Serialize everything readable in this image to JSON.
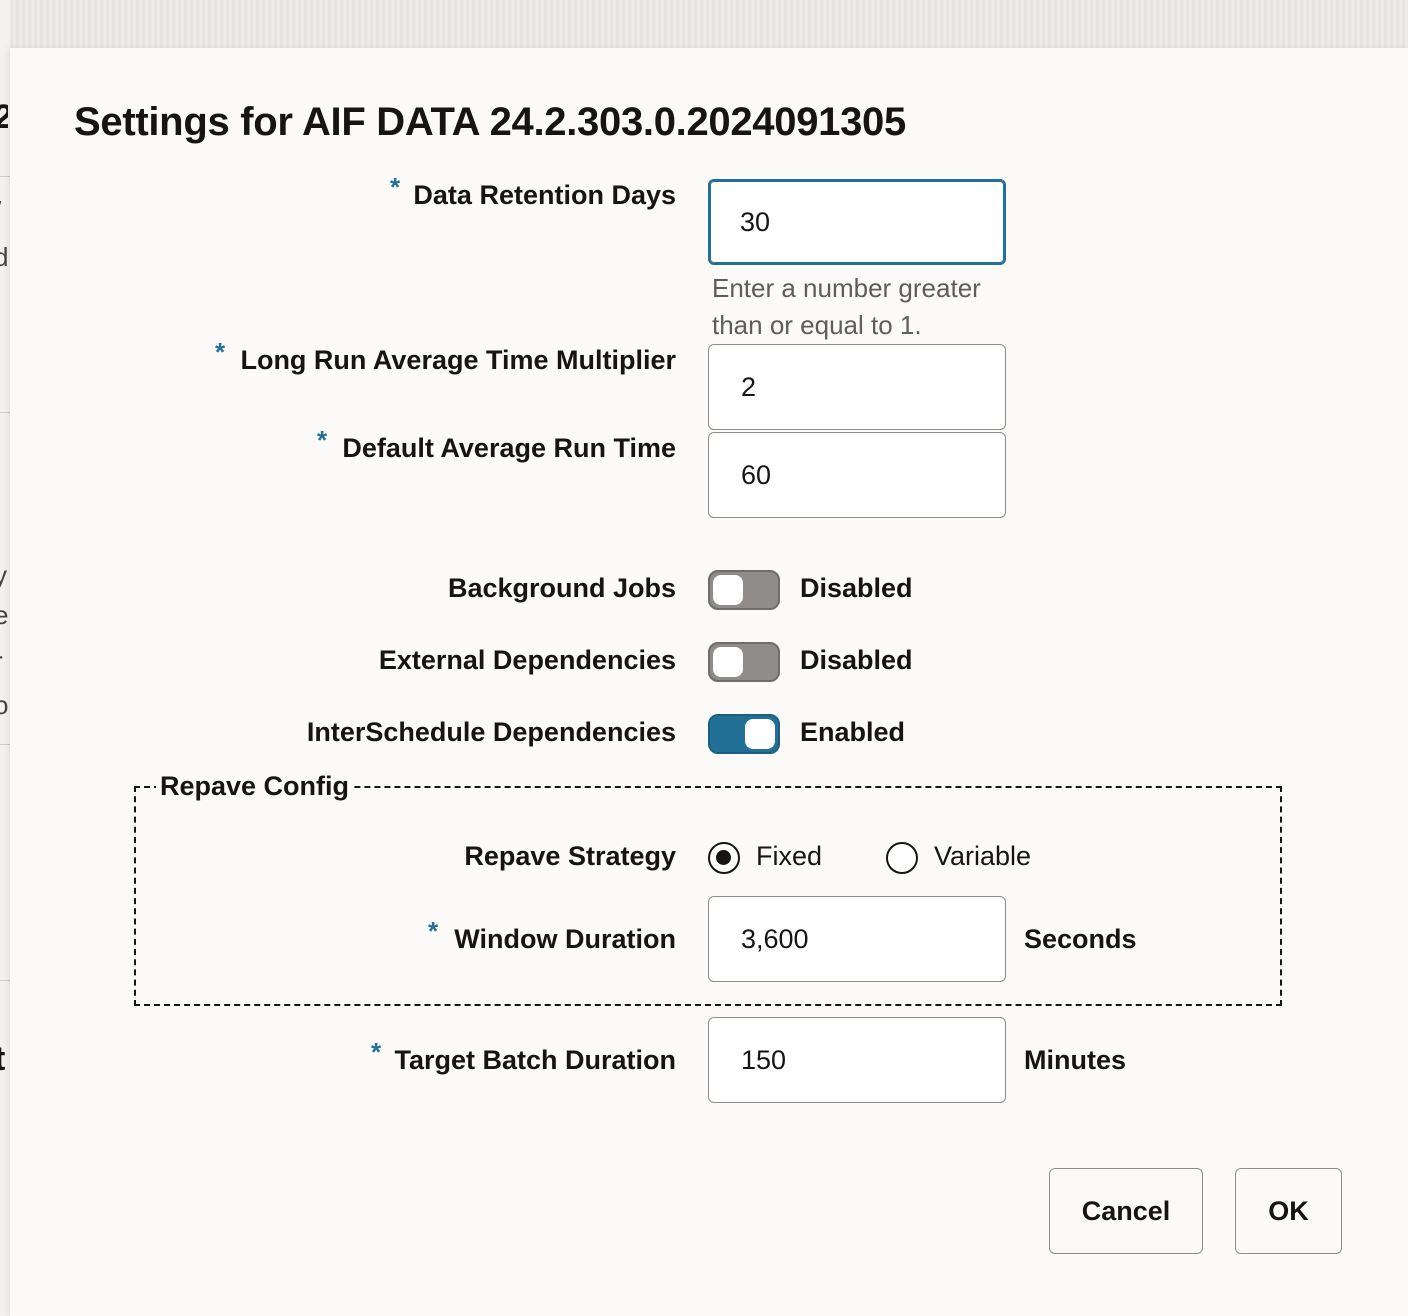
{
  "background": {
    "fragments": [
      "2",
      "/",
      "d",
      "y",
      "e",
      "r",
      "o",
      "t"
    ]
  },
  "dialog": {
    "title": "Settings for AIF DATA 24.2.303.0.2024091305",
    "required_marker": "*",
    "fields": {
      "data_retention_days": {
        "label": "Data Retention Days",
        "value": "30",
        "hint": "Enter a number greater than or equal to 1."
      },
      "long_run_multiplier": {
        "label": "Long Run Average Time Multiplier",
        "value": "2"
      },
      "default_avg_run_time": {
        "label": "Default Average Run Time",
        "value": "60"
      }
    },
    "toggles": {
      "background_jobs": {
        "label": "Background Jobs",
        "state": "Disabled",
        "on": false
      },
      "external_dependencies": {
        "label": "External Dependencies",
        "state": "Disabled",
        "on": false
      },
      "interschedule_dependencies": {
        "label": "InterSchedule Dependencies",
        "state": "Enabled",
        "on": true
      }
    },
    "repave": {
      "legend": "Repave Config",
      "strategy_label": "Repave Strategy",
      "options": [
        "Fixed",
        "Variable"
      ],
      "selected": "Fixed",
      "window_duration": {
        "label": "Window Duration",
        "value": "3,600",
        "unit": "Seconds"
      }
    },
    "target_batch_duration": {
      "label": "Target Batch Duration",
      "value": "150",
      "unit": "Minutes"
    },
    "buttons": {
      "cancel": "Cancel",
      "ok": "OK"
    }
  },
  "colors": {
    "accent": "#227096",
    "text": "#161513",
    "hint": "#5f5c59",
    "dialog_bg": "#fcfaf9"
  }
}
